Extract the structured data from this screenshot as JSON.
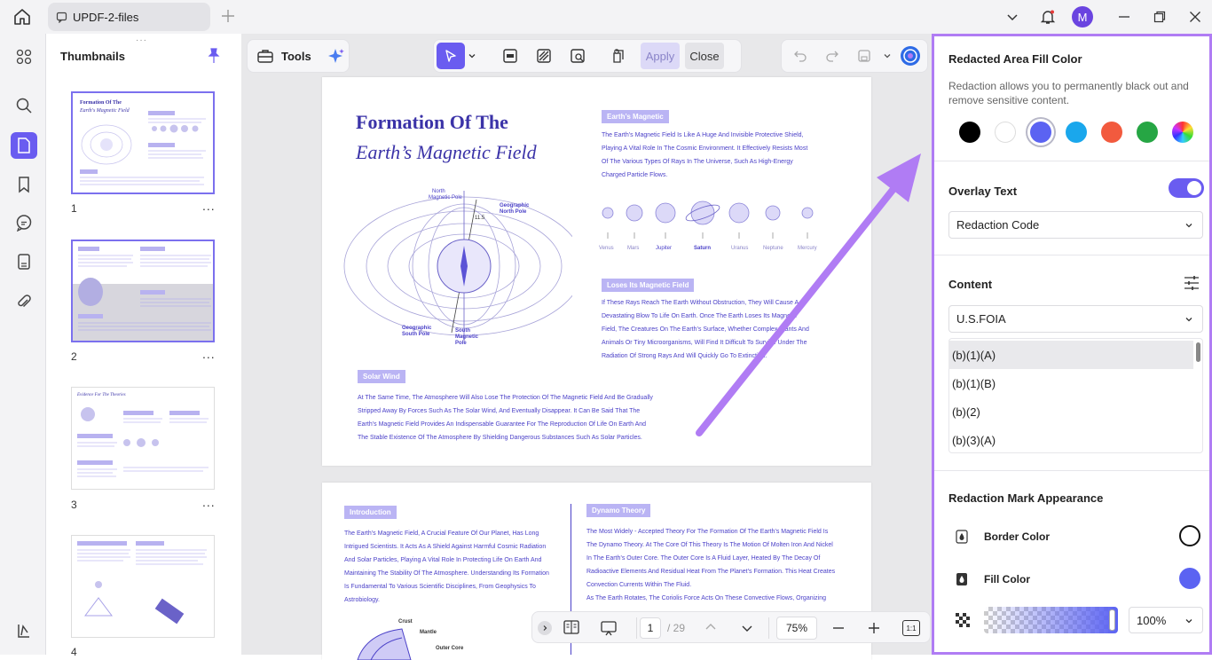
{
  "app": {
    "tab_title": "UPDF-2-files",
    "avatar_letter": "M"
  },
  "thumbnails": {
    "title": "Thumbnails",
    "pages": [
      {
        "num": "1",
        "more": "..."
      },
      {
        "num": "2",
        "more": "..."
      },
      {
        "num": "3",
        "more": "..."
      },
      {
        "num": "4",
        "more": "..."
      }
    ]
  },
  "toolbar": {
    "tools_label": "Tools",
    "apply_label": "Apply",
    "close_label": "Close"
  },
  "doc": {
    "title1": "Formation Of The",
    "title2": "Earth’s Magnetic Field",
    "sec_earth": "Earth’s Magnetic",
    "earth_text": [
      "The Earth’s Magnetic Field Is Like A Huge And Invisible Protective Shield,",
      "Playing A Vital Role In The Cosmic Environment. It Effectively Resists Most",
      "Of The Various Types Of Rays In The Universe, Such As High-Energy",
      "Charged Particle Flows."
    ],
    "planets": [
      "Venus",
      "Mars",
      "Jupiter",
      "Saturn",
      "Uranus",
      "Neptune",
      "Mercury"
    ],
    "sec_loses": "Loses Its Magnetic Field",
    "loses_text": [
      "If These Rays Reach The Earth Without Obstruction, They Will Cause A",
      "Devastating Blow To Life On Earth. Once The Earth Loses Its Magnetic",
      "Field, The Creatures On The Earth’s Surface, Whether Complex Plants And",
      "Animals Or Tiny Microorganisms, Will Find It Difficult To Survive Under The",
      "Radiation Of Strong Rays And Will Quickly Go To Extinction."
    ],
    "sec_solar": "Solar Wind",
    "solar_text": [
      "At The Same Time, The Atmosphere Will Also Lose The Protection Of The Magnetic Field And Be Gradually",
      "Stripped Away By Forces Such As The Solar Wind, And Eventually Disappear. It Can Be Said That The",
      "Earth’s Magnetic Field Provides An Indispensable Guarantee For The Reproduction Of Life On Earth And",
      "The Stable Existence Of The Atmosphere By Shielding Dangerous Substances Such As Solar Particles."
    ],
    "diagram": {
      "north_magnetic": "North Magnetic Pole",
      "geographic_north": "Geographic North Pole",
      "geographic_south": "Geographic South Pole",
      "south_magnetic": "South Magnetic Pole",
      "angle": "11.5"
    },
    "sec_intro": "Introduction",
    "intro_text": [
      "The Earth’s Magnetic Field, A Crucial Feature Of Our Planet, Has Long",
      "Intrigued Scientists. It Acts As A Shield Against Harmful Cosmic Radiation",
      "And Solar Particles, Playing A Vital Role In Protecting Life On Earth And",
      "Maintaining The Stability Of The Atmosphere. Understanding Its Formation",
      "Is Fundamental To Various Scientific Disciplines, From Geophysics To",
      "Astrobiology."
    ],
    "sec_dynamo": "Dynamo Theory",
    "dynamo_text": [
      "The Most Widely - Accepted Theory For The Formation Of The Earth’s Magnetic Field Is",
      "The Dynamo Theory. At The Core Of This Theory Is The Motion Of Molten Iron And Nickel",
      "In The Earth’s Outer Core. The Outer Core Is A Fluid Layer, Heated By The Decay Of",
      "Radioactive Elements And Residual Heat From The Planet’s Formation. This Heat Creates",
      "Convection Currents Within The Fluid.",
      "As The Earth Rotates, The Coriolis Force Acts On These Convective Flows, Organizing"
    ],
    "core_labels": {
      "crust": "Crust",
      "mantle": "Mantle",
      "outer_core": "Outer Core"
    }
  },
  "bottombar": {
    "page": "1",
    "total": "/ 29",
    "zoom": "75%",
    "fit": "1:1"
  },
  "panel": {
    "fill_title": "Redacted Area Fill Color",
    "fill_desc": "Redaction allows you to permanently black out and remove sensitive content.",
    "swatches": [
      "#000000",
      "#ffffff",
      "#5b63f2",
      "#1aa7ec",
      "#f25a3e",
      "#26a644",
      "rainbow"
    ],
    "overlay_title": "Overlay Text",
    "overlay_select": "Redaction Code",
    "content_title": "Content",
    "content_select": "U.S.FOIA",
    "codes": [
      "(b)(1)(A)",
      "(b)(1)(B)",
      "(b)(2)",
      "(b)(3)(A)"
    ],
    "appearance_title": "Redaction Mark Appearance",
    "border_label": "Border Color",
    "fill_label": "Fill Color",
    "opacity": "100%"
  },
  "colors": {
    "accent": "#6a5cf0",
    "highlight": "#b07cf4"
  }
}
